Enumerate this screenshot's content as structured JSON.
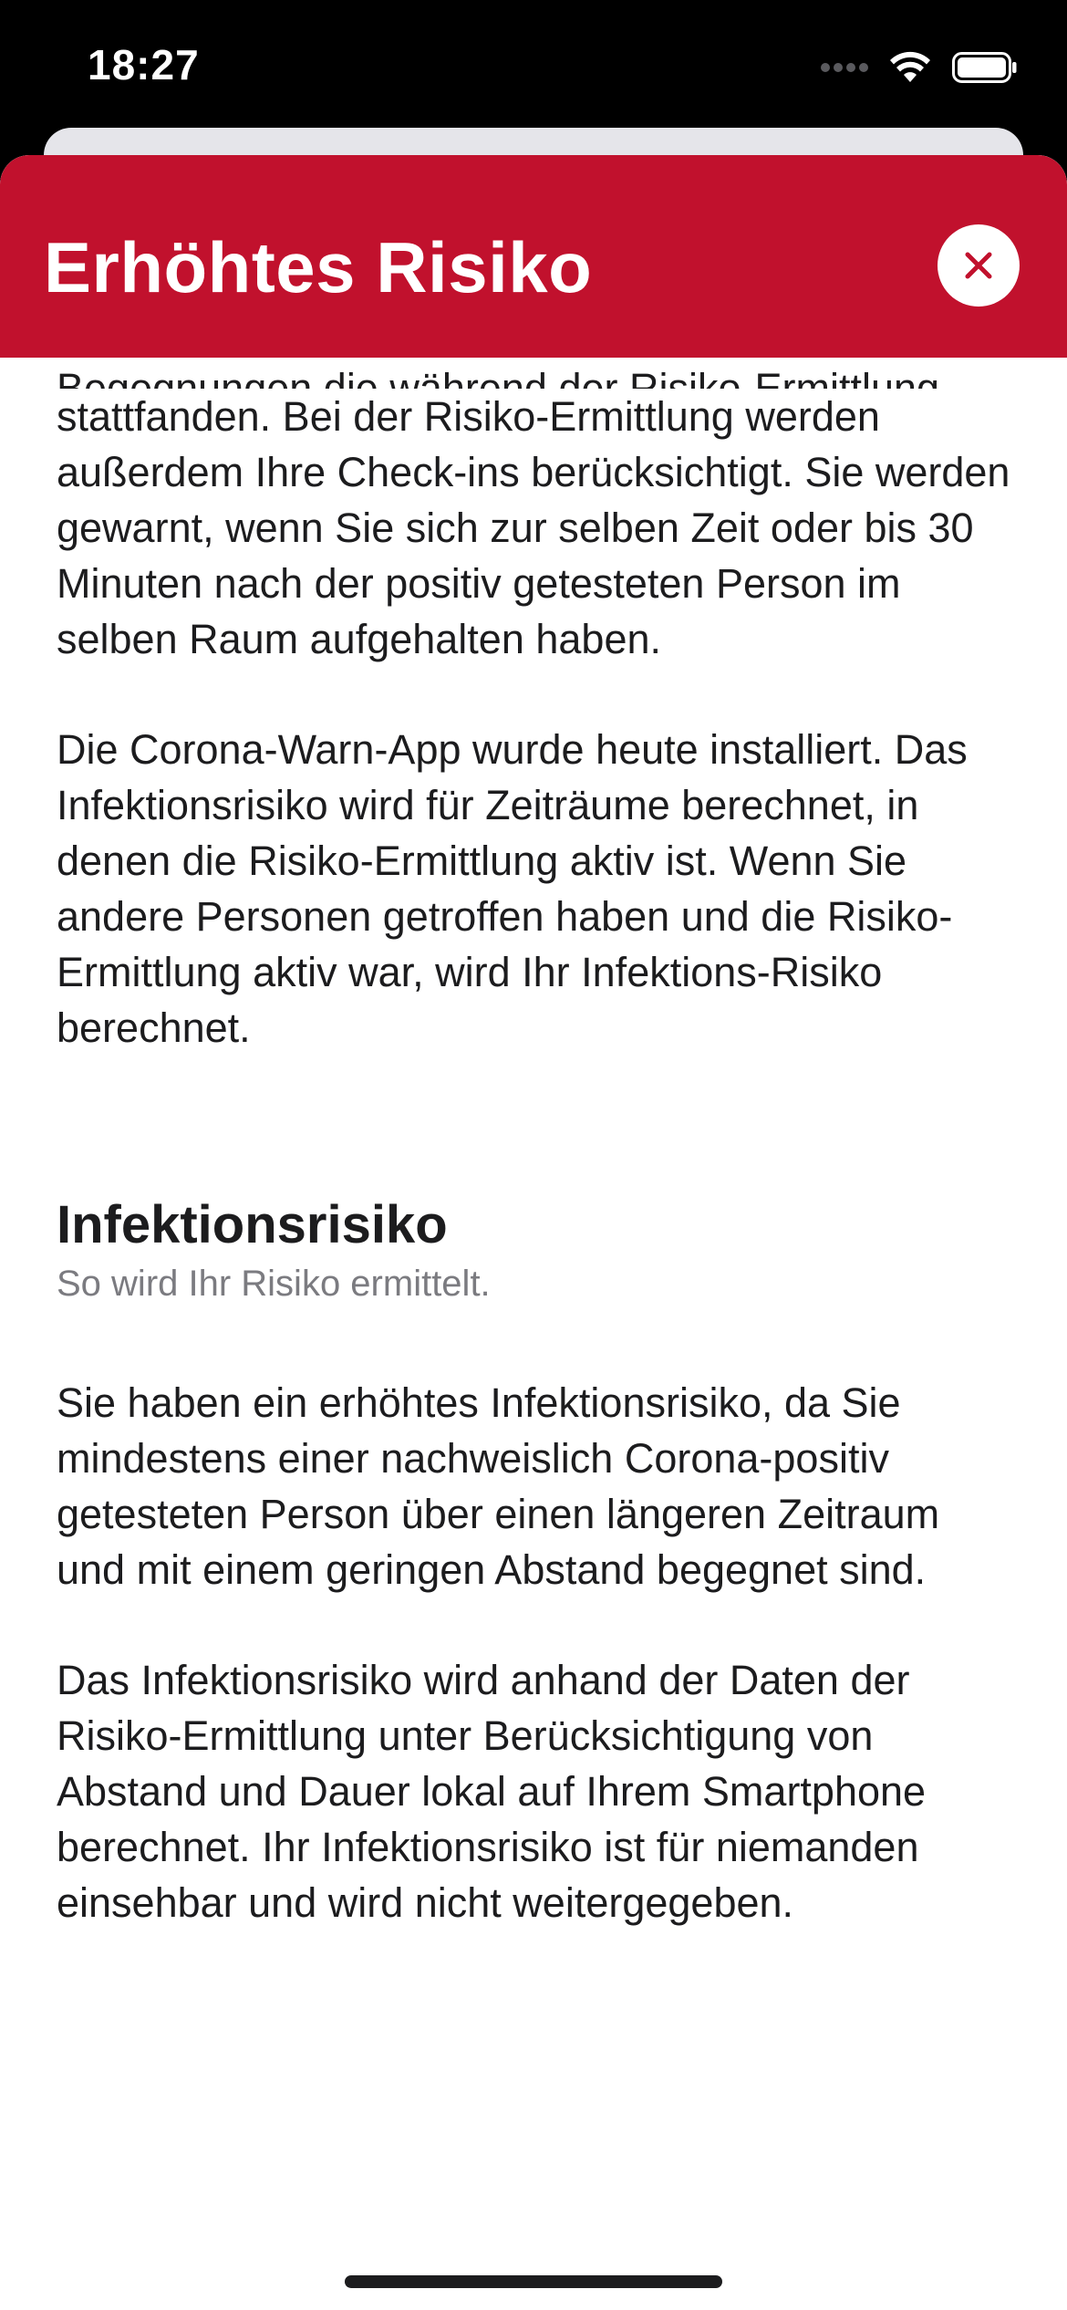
{
  "status_bar": {
    "time": "18:27"
  },
  "header": {
    "title": "Erhöhtes Risiko"
  },
  "content": {
    "cut_line": "Begegnungen die während der Risiko-Ermittlung",
    "paragraph_1": "stattfanden. Bei der Risiko-Ermittlung werden außerdem Ihre Check-ins berücksichtigt. Sie werden gewarnt, wenn Sie sich zur selben Zeit oder bis 30 Minuten nach der positiv getesteten Person im selben Raum aufgehalten haben.",
    "paragraph_2": "Die Corona-Warn-App wurde heute installiert. Das Infektionsrisiko wird für Zeiträume berechnet, in denen die Risiko-Ermittlung aktiv ist. Wenn Sie andere Personen getroffen haben und die Risiko-Ermittlung aktiv war, wird Ihr Infektions-Risiko berechnet.",
    "section": {
      "title": "Infektionsrisiko",
      "subtitle": "So wird Ihr Risiko ermittelt."
    },
    "paragraph_3": "Sie haben ein erhöhtes Infektionsrisiko, da Sie mindestens einer nachweislich Corona-positiv getesteten Person über einen längeren Zeitraum und mit einem geringen Abstand begegnet sind.",
    "paragraph_4": "Das Infektionsrisiko wird anhand der Daten der Risiko-Ermittlung unter Berücksichtigung von Abstand und Dauer lokal auf Ihrem Smartphone berechnet. Ihr Infektionsrisiko ist für niemanden einsehbar und wird nicht weitergegeben."
  },
  "colors": {
    "header_red": "#c1112d",
    "text": "#1c1c1e",
    "secondary_text": "#7b7b80"
  }
}
